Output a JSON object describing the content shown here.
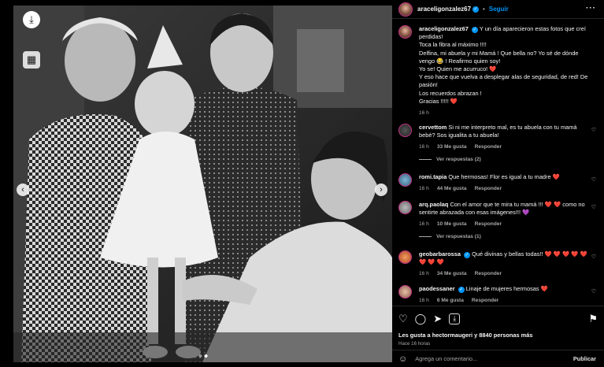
{
  "photo": {
    "download_icon": "download-icon",
    "grid_icon": "grid-icon",
    "prev_icon": "chevron-left-icon",
    "next_icon": "chevron-right-icon",
    "bottom_download_icon": "download-icon"
  },
  "header": {
    "username": "araceligonzalez67",
    "verified": "✓",
    "dot": "•",
    "follow": "Seguir",
    "more": "···"
  },
  "caption": {
    "username": "araceligonzalez67",
    "lines": [
      "Y un día aparecieron estas fotos que creí perdidas!",
      "Toca la fibra al máximo !!!!",
      "Delfina, mi abuela y mi Mamá ! Que bella no? Yo sé de dónde vengo 😂 ! Reafirmo quien soy!",
      "Yo se! Quien me acurruco! ❤️",
      "Y eso hace que vuelva a desplegar alas de seguridad, de red! De pasión!",
      "Los recuerdos abrazan !",
      "Gracias !!!!! ❤️"
    ],
    "time": "16 h"
  },
  "comments": [
    {
      "user": "cervettom",
      "text": "Si ni me interpreto mal, es tu abuela con tu mamá bebé? Sos igualita a tu abuela!",
      "time": "16 h",
      "likes": "33 Me gusta",
      "reply": "Responder",
      "view_replies": "Ver respuestas (2)"
    },
    {
      "user": "romi.tapia",
      "text": "Que hermosas! Flor es igual a tu madre ❤️",
      "time": "16 h",
      "likes": "44 Me gusta",
      "reply": "Responder"
    },
    {
      "user": "arq.paolaq",
      "text": "Con el amor que te mira tu mamá !!! ❤️ ❤️ como no sentirte abrazada con esas imágenes!!! 💜",
      "time": "16 h",
      "likes": "10 Me gusta",
      "reply": "Responder",
      "view_replies": "Ver respuestas (1)"
    },
    {
      "user": "geobarbarossa",
      "text": "Qué divinas y bellas todas!! ❤️ ❤️ ❤️ ❤️ ❤️ ❤️ ❤️ ❤️",
      "time": "16 h",
      "likes": "34 Me gusta",
      "reply": "Responder"
    },
    {
      "user": "paodessaner",
      "text": "Linaje de mujeres hermosas ❤️",
      "time": "16 h",
      "likes": "6 Me gusta",
      "reply": "Responder"
    }
  ],
  "actions": {
    "like_icon": "heart-icon",
    "comment_icon": "comment-icon",
    "share_icon": "send-icon",
    "save_icon": "bookmark-icon",
    "likes_text": "Les gusta a hectormaugeri y 8840 personas más",
    "time": "Hace 16 horas"
  },
  "add_comment": {
    "emoji_icon": "emoji-icon",
    "placeholder": "Agrega un comentario...",
    "publish": "Publicar"
  }
}
